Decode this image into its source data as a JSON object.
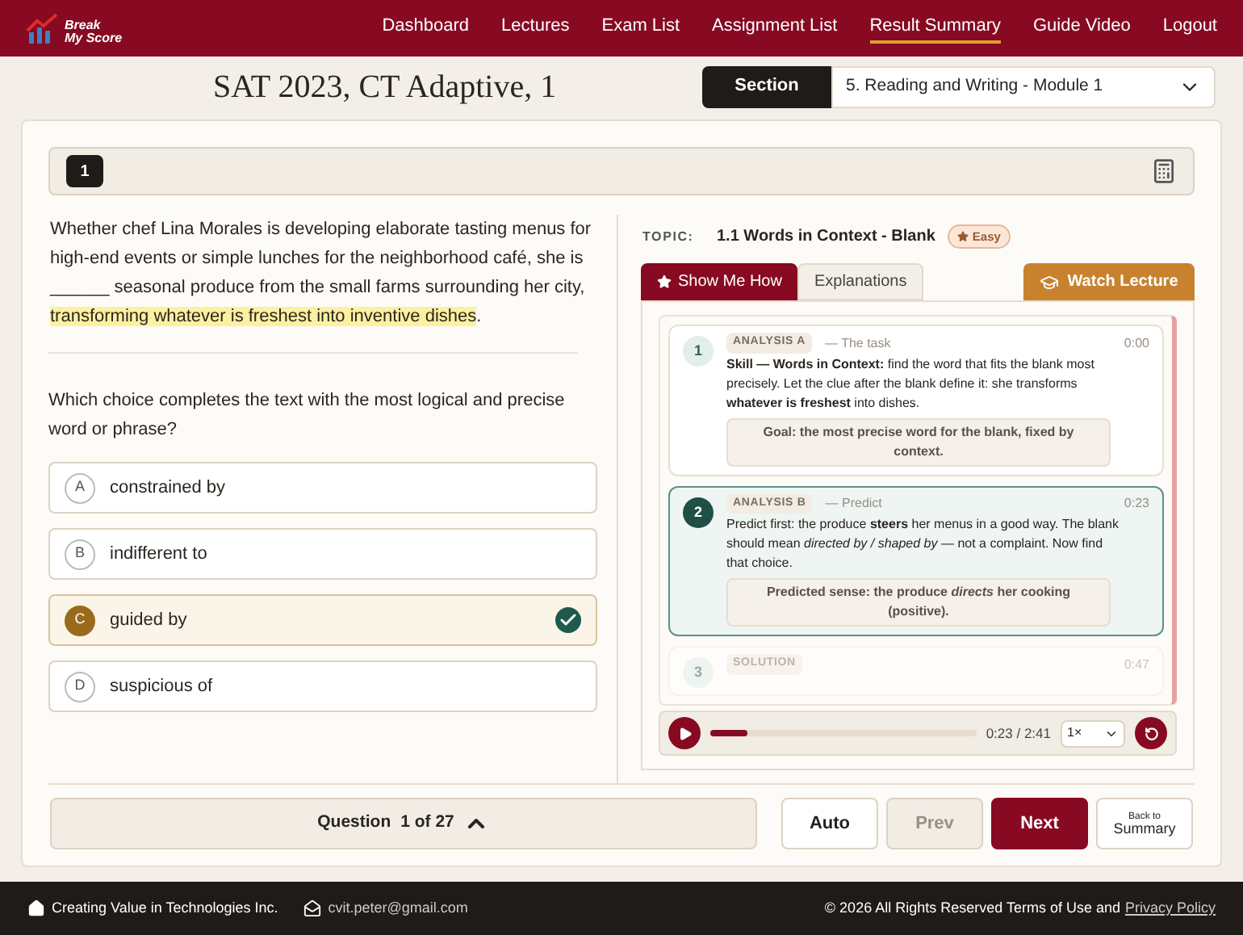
{
  "brand": {
    "line1": "Break",
    "line2": "My Score"
  },
  "nav": [
    {
      "label": "Dashboard",
      "selected": false
    },
    {
      "label": "Lectures",
      "selected": false
    },
    {
      "label": "Exam List",
      "selected": false
    },
    {
      "label": "Assignment List",
      "selected": false
    },
    {
      "label": "Result Summary",
      "selected": true
    },
    {
      "label": "Guide Video",
      "selected": false
    },
    {
      "label": "Logout",
      "selected": false
    }
  ],
  "exam_title": "SAT 2023, CT Adaptive, 1",
  "section": {
    "label": "Section",
    "value": "5. Reading and Writing - Module 1"
  },
  "question": {
    "number": "1",
    "passage": {
      "before": "Whether chef Lina Morales is developing elaborate tasting menus for high-end events or simple lunches for the neighborhood café, she is ______ seasonal produce from the small farms surrounding her city, ",
      "highlighted": "transforming whatever is freshest into inventive dishes",
      "after": "."
    },
    "prompt": "Which choice completes the text with the most logical and precise word or phrase?",
    "choices": [
      {
        "letter": "A",
        "text": "constrained by",
        "selected": false,
        "correct": false
      },
      {
        "letter": "B",
        "text": "indifferent to",
        "selected": false,
        "correct": false
      },
      {
        "letter": "C",
        "text": "guided by",
        "selected": true,
        "correct": true
      },
      {
        "letter": "D",
        "text": "suspicious of",
        "selected": false,
        "correct": false
      }
    ]
  },
  "topic": {
    "label": "TOPIC:",
    "name": "1.1 Words in Context - Blank",
    "difficulty": "Easy"
  },
  "tabs": [
    {
      "label": "Show Me How",
      "selected": true
    },
    {
      "label": "Explanations",
      "selected": false
    }
  ],
  "lecture_button": "Watch Lecture",
  "steps": [
    {
      "number": "1",
      "tag": "ANALYSIS A",
      "subtitle": "— The task",
      "time": "0:00",
      "kind": "done",
      "body": "**Skill — Words in Context:** find the word that fits the blank most precisely. Let the clue after the blank define it: she transforms **whatever is freshest** into dishes.",
      "note": "Goal: the most precise word for the blank, fixed by context."
    },
    {
      "number": "2",
      "tag": "ANALYSIS B",
      "subtitle": "— Predict",
      "time": "0:23",
      "kind": "current",
      "body": "Predict first: the produce **steers** her menus in a good way. The blank should mean *directed by / shaped by* — not a complaint. Now find that choice.",
      "note": "Predicted sense: the produce *directs* her cooking (positive)."
    },
    {
      "number": "3",
      "tag": "SOLUTION",
      "time": "0:47",
      "kind": "upcoming"
    }
  ],
  "player": {
    "level": 0.14,
    "time": "0:23 / 2:41",
    "speed": "1×"
  },
  "pager": {
    "label": "Question",
    "position": "1 of 27"
  },
  "buttons": [
    {
      "label": "Auto",
      "kind": "plain",
      "disabled": false
    },
    {
      "label": "Prev",
      "kind": "plain",
      "disabled": true
    },
    {
      "label": "Next",
      "kind": "primary",
      "disabled": false
    }
  ],
  "summary_button": {
    "small": "Back to",
    "label": "Summary"
  },
  "footer": {
    "company": "Creating Value in Technologies Inc.",
    "email": "cvit.peter@gmail.com",
    "copyright": "© 2026 All Rights Reserved Terms of Use and",
    "privacy": "Privacy Policy"
  }
}
